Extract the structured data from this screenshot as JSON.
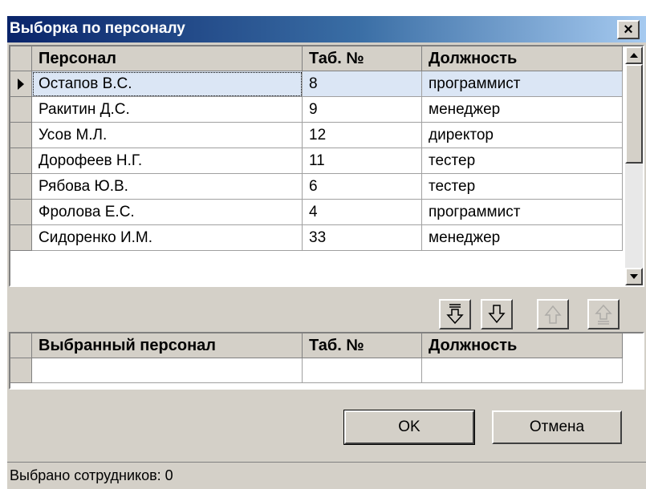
{
  "window": {
    "title": "Выборка по персоналу",
    "close_label": "×"
  },
  "personnel_grid": {
    "columns": [
      "Персонал",
      "Таб. №",
      "Должность"
    ],
    "rows": [
      {
        "name": "Остапов В.С.",
        "tab": "8",
        "position": "программист",
        "selected": true
      },
      {
        "name": "Ракитин Д.С.",
        "tab": "9",
        "position": "менеджер"
      },
      {
        "name": "Усов М.Л.",
        "tab": "12",
        "position": "директор"
      },
      {
        "name": "Дорофеев Н.Г.",
        "tab": "11",
        "position": "тестер"
      },
      {
        "name": "Рябова Ю.В.",
        "tab": "6",
        "position": "тестер"
      },
      {
        "name": "Фролова Е.С.",
        "tab": "4",
        "position": "программист"
      },
      {
        "name": "Сидоренко И.М.",
        "tab": "33",
        "position": "менеджер"
      }
    ]
  },
  "transfer_buttons": [
    {
      "name": "move-all-down-button",
      "icon": "double-arrow-down-icon",
      "enabled": true
    },
    {
      "name": "move-down-button",
      "icon": "arrow-down-icon",
      "enabled": true
    },
    {
      "name": "move-up-button",
      "icon": "arrow-up-icon",
      "enabled": false
    },
    {
      "name": "move-all-up-button",
      "icon": "double-arrow-up-icon",
      "enabled": false
    }
  ],
  "selected_grid": {
    "columns": [
      "Выбранный персонал",
      "Таб. №",
      "Должность"
    ],
    "rows": []
  },
  "buttons": {
    "ok": "OK",
    "cancel": "Отмена"
  },
  "status": {
    "text": "Выбрано сотрудников: 0"
  },
  "colors": {
    "title_gradient_start": "#0a246a",
    "title_gradient_end": "#a6caf0",
    "face": "#d4d0c8",
    "selection": "#dbe6f5"
  }
}
